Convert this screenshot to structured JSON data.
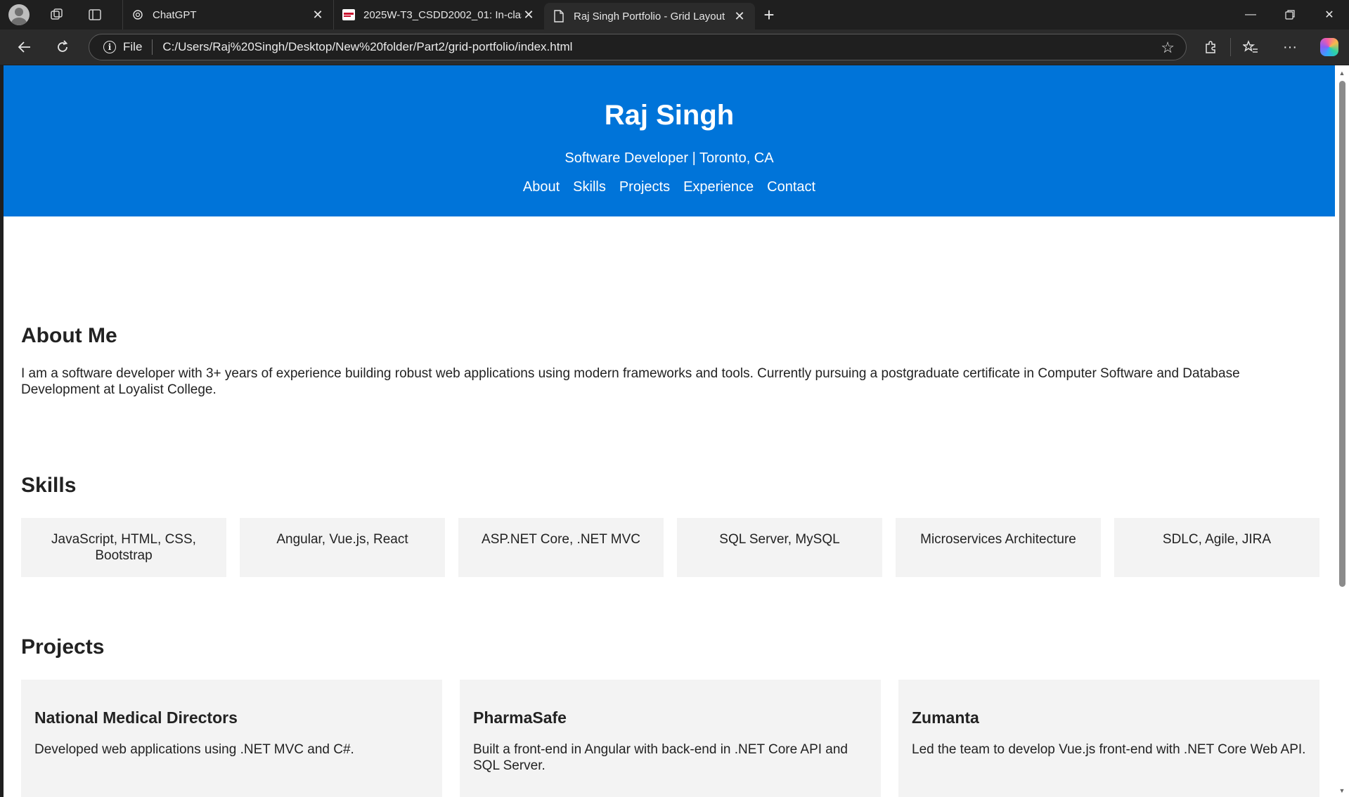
{
  "browser": {
    "tabs": [
      {
        "title": "ChatGPT",
        "active": false
      },
      {
        "title": "2025W-T3_CSDD2002_01: In-class",
        "active": false
      },
      {
        "title": "Raj Singh Portfolio - Grid Layout",
        "active": true
      }
    ],
    "address": {
      "scheme_label": "File",
      "url": "C:/Users/Raj%20Singh/Desktop/New%20folder/Part2/grid-portfolio/index.html"
    }
  },
  "site": {
    "name": "Raj Singh",
    "tagline": "Software Developer | Toronto, CA",
    "nav": [
      "About",
      "Skills",
      "Projects",
      "Experience",
      "Contact"
    ],
    "header_color": "#0074d9"
  },
  "about": {
    "title": "About Me",
    "text": "I am a software developer with 3+ years of experience building robust web applications using modern frameworks and tools. Currently pursuing a postgraduate certificate in Computer Software and Database Development at Loyalist College."
  },
  "skills": {
    "title": "Skills",
    "items": [
      "JavaScript, HTML, CSS, Bootstrap",
      "Angular, Vue.js, React",
      "ASP.NET Core, .NET MVC",
      "SQL Server, MySQL",
      "Microservices Architecture",
      "SDLC, Agile, JIRA"
    ]
  },
  "projects": {
    "title": "Projects",
    "items": [
      {
        "name": "National Medical Directors",
        "desc": "Developed web applications using .NET MVC and C#."
      },
      {
        "name": "PharmaSafe",
        "desc": "Built a front-end in Angular with back-end in .NET Core API and SQL Server."
      },
      {
        "name": "Zumanta",
        "desc": "Led the team to develop Vue.js front-end with .NET Core Web API."
      }
    ]
  }
}
